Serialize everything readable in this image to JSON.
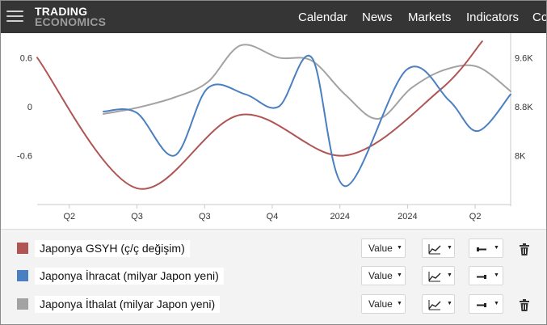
{
  "navbar": {
    "logo_line1": "TRADING",
    "logo_line2": "ECONOMICS",
    "links": [
      "Calendar",
      "News",
      "Markets",
      "Indicators",
      "Co"
    ]
  },
  "chart_data": {
    "type": "line",
    "x_tick_labels": [
      "Q2",
      "Q3",
      "Q3",
      "Q4",
      "2024",
      "2024",
      "Q2"
    ],
    "y_left": {
      "ticks": [
        "0.6",
        "0",
        "-0.6"
      ],
      "range": [
        -1.2,
        0.9
      ]
    },
    "y_right": {
      "ticks": [
        "9.6K",
        "8.8K",
        "8K"
      ],
      "range": [
        7.2,
        10.0
      ]
    },
    "grid": false,
    "series": [
      {
        "name": "Japonya GSYH (ç/ç değişim)",
        "color": "#b05454",
        "axis": "left",
        "points": [
          [
            0.0,
            0.6
          ],
          [
            0.21,
            -1.0
          ],
          [
            0.43,
            -0.1
          ],
          [
            0.65,
            -0.6
          ],
          [
            0.85,
            0.2
          ],
          [
            0.94,
            0.8
          ]
        ]
      },
      {
        "name": "Japonya İhracat (milyar Japon yeni)",
        "color": "#4a7fc1",
        "axis": "right",
        "points": [
          [
            0.14,
            8.72
          ],
          [
            0.21,
            8.7
          ],
          [
            0.29,
            8.0
          ],
          [
            0.36,
            9.1
          ],
          [
            0.44,
            9.0
          ],
          [
            0.51,
            8.8
          ],
          [
            0.58,
            9.6
          ],
          [
            0.65,
            7.5
          ],
          [
            0.78,
            9.4
          ],
          [
            0.87,
            8.9
          ],
          [
            0.93,
            8.4
          ],
          [
            1.0,
            9.0
          ]
        ]
      },
      {
        "name": "Japonya İthalat (milyar Japon yeni)",
        "color": "#a3a3a3",
        "axis": "right",
        "points": [
          [
            0.14,
            8.68
          ],
          [
            0.21,
            8.78
          ],
          [
            0.29,
            8.95
          ],
          [
            0.36,
            9.2
          ],
          [
            0.43,
            9.8
          ],
          [
            0.51,
            9.6
          ],
          [
            0.58,
            9.55
          ],
          [
            0.65,
            9.0
          ],
          [
            0.72,
            8.6
          ],
          [
            0.79,
            9.1
          ],
          [
            0.86,
            9.4
          ],
          [
            0.93,
            9.45
          ],
          [
            1.0,
            9.05
          ]
        ]
      }
    ]
  },
  "legend": {
    "value_label": "Value",
    "rows": [
      {
        "name": "Japonya GSYH (ç/ç değişim)",
        "color": "#b05454",
        "deletable": true,
        "axis_side": "left"
      },
      {
        "name": "Japonya İhracat (milyar Japon yeni)",
        "color": "#4a7fc1",
        "deletable": false,
        "axis_side": "right"
      },
      {
        "name": "Japonya İthalat (milyar Japon yeni)",
        "color": "#a3a3a3",
        "deletable": true,
        "axis_side": "right"
      }
    ]
  }
}
